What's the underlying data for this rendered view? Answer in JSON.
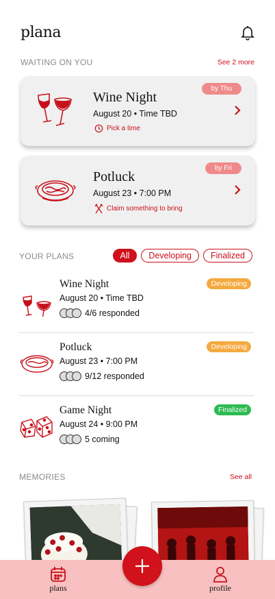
{
  "app": {
    "title": "plana"
  },
  "waiting": {
    "title": "WAITING ON YOU",
    "see_more": "See 2 more",
    "cards": [
      {
        "title": "Wine Night",
        "subtitle": "August 20 • Time TBD",
        "action": "Pick a time",
        "badge": "by Thu",
        "icon": "wine-glasses-icon"
      },
      {
        "title": "Potluck",
        "subtitle": "August 23 • 7:00 PM",
        "action": "Claim something to bring",
        "badge": "by Fri",
        "icon": "casserole-dish-icon"
      }
    ]
  },
  "plans": {
    "title": "YOUR PLANS",
    "filters": [
      "All",
      "Developing",
      "Finalized"
    ],
    "active_filter": "All",
    "items": [
      {
        "title": "Wine Night",
        "subtitle": "August 20 • Time TBD",
        "responses": "4/6 responded",
        "status": "Developing",
        "icon": "wine-glasses-icon"
      },
      {
        "title": "Potluck",
        "subtitle": "August 23 • 7:00 PM",
        "responses": "9/12 responded",
        "status": "Developing",
        "icon": "casserole-dish-icon"
      },
      {
        "title": "Game Night",
        "subtitle": "August 24 • 9:00 PM",
        "responses": "5 coming",
        "status": "Finalized",
        "icon": "dice-icon"
      }
    ]
  },
  "memories": {
    "title": "MEMORIES",
    "see_all": "See all"
  },
  "nav": {
    "plans": "plans",
    "profile": "profile"
  },
  "colors": {
    "accent": "#d1111b",
    "developing": "#f4a940",
    "finalized": "#2cba52",
    "bar": "#f8c0c0"
  }
}
